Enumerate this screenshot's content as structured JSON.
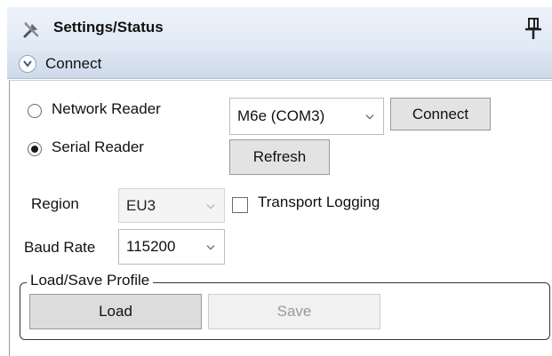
{
  "panel": {
    "title": "Settings/Status",
    "icon": "tools-icon",
    "pin_icon": "pin-icon"
  },
  "section": {
    "title": "Connect",
    "expanded": true
  },
  "connection_type": {
    "options": [
      {
        "label": "Network Reader",
        "selected": false
      },
      {
        "label": "Serial Reader",
        "selected": true
      }
    ]
  },
  "reader_select": {
    "value": "M6e (COM3)"
  },
  "buttons": {
    "connect": "Connect",
    "refresh": "Refresh"
  },
  "region": {
    "label": "Region",
    "value": "EU3",
    "enabled": false
  },
  "transport_logging": {
    "label": "Transport Logging",
    "checked": false
  },
  "baud_rate": {
    "label": "Baud Rate",
    "value": "115200"
  },
  "profile": {
    "legend": "Load/Save Profile",
    "load_label": "Load",
    "save_label": "Save",
    "save_enabled": false
  }
}
